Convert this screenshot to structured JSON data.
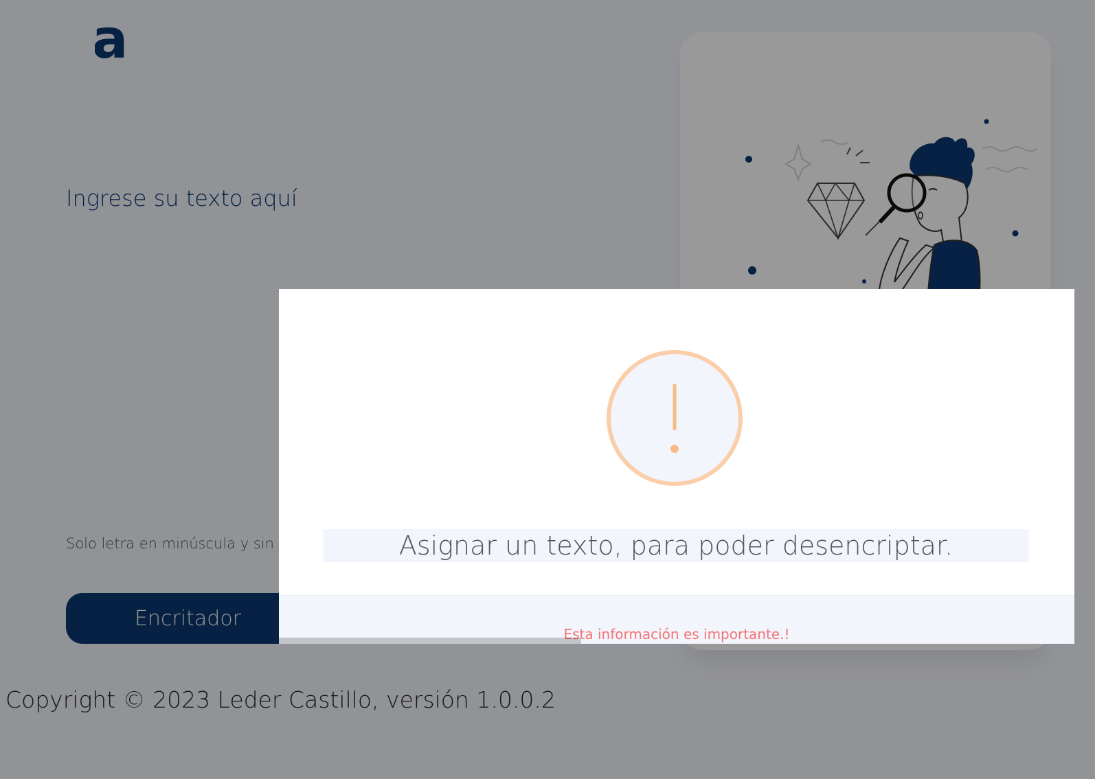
{
  "app": {
    "logo_letter": "a"
  },
  "input": {
    "placeholder": "Ingrese su texto aquí"
  },
  "hint": {
    "text": "Solo letra en minúscula y sin a"
  },
  "buttons": {
    "encrypt_label": "Encritador"
  },
  "footer": {
    "copyright": "Copyright © 2023 Leder Castillo, versión 1.0.0.2"
  },
  "modal": {
    "icon": "warning-icon",
    "icon_glyph": "!",
    "icon_color": "#facea8",
    "message": "Asignar un texto, para poder desencriptar.",
    "footer_text": "Esta información es importante.!",
    "footer_color": "#f27474",
    "timer_progress": 0.38
  },
  "colors": {
    "brand": "#0a3871",
    "page_background": "#f3f5fc"
  }
}
